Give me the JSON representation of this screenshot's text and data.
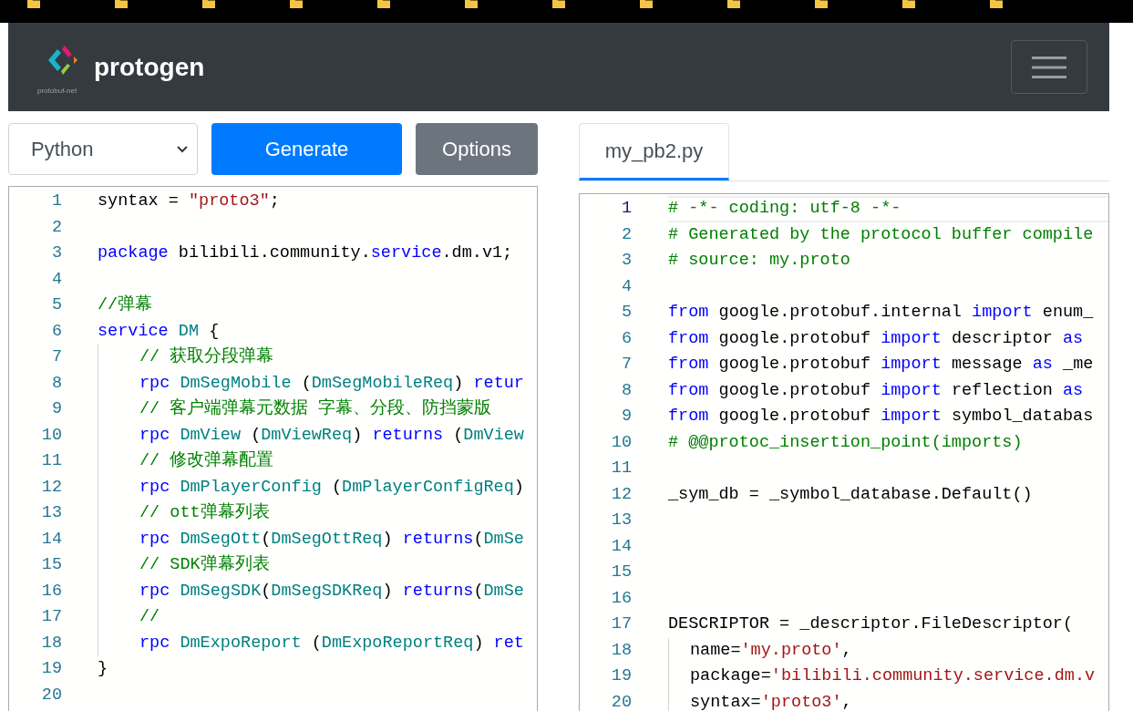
{
  "navbar": {
    "brand": "protogen",
    "logo_subtitle": "protobuf-net"
  },
  "toolbar": {
    "language": "Python",
    "generate": "Generate",
    "options": "Options"
  },
  "input_editor": {
    "lines": [
      {
        "number": "1",
        "indent": false,
        "tokens": [
          {
            "kind": "plain",
            "text": "syntax = "
          },
          {
            "kind": "str",
            "text": "\"proto3\""
          },
          {
            "kind": "plain",
            "text": ";"
          }
        ]
      },
      {
        "number": "2",
        "indent": false
      },
      {
        "number": "3",
        "indent": false,
        "tokens": [
          {
            "kind": "kw",
            "text": "package"
          },
          {
            "kind": "plain",
            "text": " bilibili.community."
          },
          {
            "kind": "kw",
            "text": "service"
          },
          {
            "kind": "plain",
            "text": ".dm.v1;"
          }
        ]
      },
      {
        "number": "4",
        "indent": false
      },
      {
        "number": "5",
        "indent": false,
        "tokens": [
          {
            "kind": "cm",
            "text": "//弹幕"
          }
        ]
      },
      {
        "number": "6",
        "indent": false,
        "tokens": [
          {
            "kind": "kw",
            "text": "service"
          },
          {
            "kind": "type",
            "text": " DM"
          },
          {
            "kind": "plain",
            "text": " {"
          }
        ]
      },
      {
        "number": "7",
        "indent": true,
        "tokens": [
          {
            "kind": "cm",
            "text": "// 获取分段弹幕"
          }
        ]
      },
      {
        "number": "8",
        "indent": true,
        "tokens": [
          {
            "kind": "kw",
            "text": "rpc"
          },
          {
            "kind": "type",
            "text": " DmSegMobile"
          },
          {
            "kind": "plain",
            "text": " ("
          },
          {
            "kind": "type",
            "text": "DmSegMobileReq"
          },
          {
            "kind": "plain",
            "text": ") "
          },
          {
            "kind": "kw",
            "text": "retur"
          }
        ]
      },
      {
        "number": "9",
        "indent": true,
        "tokens": [
          {
            "kind": "cm",
            "text": "// 客户端弹幕元数据 字幕、分段、防挡蒙版"
          }
        ]
      },
      {
        "number": "10",
        "indent": true,
        "tokens": [
          {
            "kind": "kw",
            "text": "rpc"
          },
          {
            "kind": "type",
            "text": " DmView"
          },
          {
            "kind": "plain",
            "text": " ("
          },
          {
            "kind": "type",
            "text": "DmViewReq"
          },
          {
            "kind": "plain",
            "text": ") "
          },
          {
            "kind": "kw",
            "text": "returns"
          },
          {
            "kind": "plain",
            "text": " ("
          },
          {
            "kind": "type",
            "text": "DmView"
          }
        ]
      },
      {
        "number": "11",
        "indent": true,
        "tokens": [
          {
            "kind": "cm",
            "text": "// 修改弹幕配置"
          }
        ]
      },
      {
        "number": "12",
        "indent": true,
        "tokens": [
          {
            "kind": "kw",
            "text": "rpc"
          },
          {
            "kind": "type",
            "text": " DmPlayerConfig"
          },
          {
            "kind": "plain",
            "text": " ("
          },
          {
            "kind": "type",
            "text": "DmPlayerConfigReq"
          },
          {
            "kind": "plain",
            "text": ")"
          }
        ]
      },
      {
        "number": "13",
        "indent": true,
        "tokens": [
          {
            "kind": "cm",
            "text": "// ott弹幕列表"
          }
        ]
      },
      {
        "number": "14",
        "indent": true,
        "tokens": [
          {
            "kind": "kw",
            "text": "rpc"
          },
          {
            "kind": "type",
            "text": " DmSegOtt"
          },
          {
            "kind": "plain",
            "text": "("
          },
          {
            "kind": "type",
            "text": "DmSegOttReq"
          },
          {
            "kind": "plain",
            "text": ") "
          },
          {
            "kind": "kw",
            "text": "returns"
          },
          {
            "kind": "plain",
            "text": "("
          },
          {
            "kind": "type",
            "text": "DmSe"
          }
        ]
      },
      {
        "number": "15",
        "indent": true,
        "tokens": [
          {
            "kind": "cm",
            "text": "// SDK弹幕列表"
          }
        ]
      },
      {
        "number": "16",
        "indent": true,
        "tokens": [
          {
            "kind": "kw",
            "text": "rpc"
          },
          {
            "kind": "type",
            "text": " DmSegSDK"
          },
          {
            "kind": "plain",
            "text": "("
          },
          {
            "kind": "type",
            "text": "DmSegSDKReq"
          },
          {
            "kind": "plain",
            "text": ") "
          },
          {
            "kind": "kw",
            "text": "returns"
          },
          {
            "kind": "plain",
            "text": "("
          },
          {
            "kind": "type",
            "text": "DmSe"
          }
        ]
      },
      {
        "number": "17",
        "indent": true,
        "tokens": [
          {
            "kind": "cm",
            "text": "//"
          }
        ]
      },
      {
        "number": "18",
        "indent": true,
        "tokens": [
          {
            "kind": "kw",
            "text": "rpc"
          },
          {
            "kind": "type",
            "text": " DmExpoReport"
          },
          {
            "kind": "plain",
            "text": " ("
          },
          {
            "kind": "type",
            "text": "DmExpoReportReq"
          },
          {
            "kind": "plain",
            "text": ") "
          },
          {
            "kind": "kw",
            "text": "ret"
          }
        ]
      },
      {
        "number": "19",
        "indent": false,
        "tokens": [
          {
            "kind": "plain",
            "text": "}"
          }
        ]
      },
      {
        "number": "20",
        "indent": false
      }
    ]
  },
  "output_tabs": [
    {
      "label": "my_pb2.py",
      "selected": true
    }
  ],
  "output_editor": {
    "lines": [
      {
        "number": "1",
        "indent": false,
        "active": true,
        "tokens": [
          {
            "kind": "cm",
            "text": "# -*- coding: utf-8 -*-"
          }
        ]
      },
      {
        "number": "2",
        "indent": false,
        "active": false,
        "tokens": [
          {
            "kind": "cm",
            "text": "# Generated by the protocol buffer compile"
          }
        ]
      },
      {
        "number": "3",
        "indent": false,
        "active": false,
        "tokens": [
          {
            "kind": "cm",
            "text": "# source: my.proto"
          }
        ]
      },
      {
        "number": "4",
        "indent": false,
        "active": false
      },
      {
        "number": "5",
        "indent": false,
        "active": false,
        "tokens": [
          {
            "kind": "kw",
            "text": "from"
          },
          {
            "kind": "plain",
            "text": " google.protobuf.internal "
          },
          {
            "kind": "kw",
            "text": "import"
          },
          {
            "kind": "plain",
            "text": " enum_"
          }
        ]
      },
      {
        "number": "6",
        "indent": false,
        "active": false,
        "tokens": [
          {
            "kind": "kw",
            "text": "from"
          },
          {
            "kind": "plain",
            "text": " google.protobuf "
          },
          {
            "kind": "kw",
            "text": "import"
          },
          {
            "kind": "plain",
            "text": " descriptor "
          },
          {
            "kind": "kw",
            "text": "as"
          }
        ]
      },
      {
        "number": "7",
        "indent": false,
        "active": false,
        "tokens": [
          {
            "kind": "kw",
            "text": "from"
          },
          {
            "kind": "plain",
            "text": " google.protobuf "
          },
          {
            "kind": "kw",
            "text": "import"
          },
          {
            "kind": "plain",
            "text": " message "
          },
          {
            "kind": "kw",
            "text": "as"
          },
          {
            "kind": "plain",
            "text": " _me"
          }
        ]
      },
      {
        "number": "8",
        "indent": false,
        "active": false,
        "tokens": [
          {
            "kind": "kw",
            "text": "from"
          },
          {
            "kind": "plain",
            "text": " google.protobuf "
          },
          {
            "kind": "kw",
            "text": "import"
          },
          {
            "kind": "plain",
            "text": " reflection "
          },
          {
            "kind": "kw",
            "text": "as"
          }
        ]
      },
      {
        "number": "9",
        "indent": false,
        "active": false,
        "tokens": [
          {
            "kind": "kw",
            "text": "from"
          },
          {
            "kind": "plain",
            "text": " google.protobuf "
          },
          {
            "kind": "kw",
            "text": "import"
          },
          {
            "kind": "plain",
            "text": " symbol_databas"
          }
        ]
      },
      {
        "number": "10",
        "indent": false,
        "active": false,
        "tokens": [
          {
            "kind": "cm",
            "text": "# @@protoc_insertion_point(imports)"
          }
        ]
      },
      {
        "number": "11",
        "indent": false,
        "active": false
      },
      {
        "number": "12",
        "indent": false,
        "active": false,
        "tokens": [
          {
            "kind": "plain",
            "text": "_sym_db = _symbol_database.Default()"
          }
        ]
      },
      {
        "number": "13",
        "indent": false,
        "active": false
      },
      {
        "number": "14",
        "indent": false,
        "active": false
      },
      {
        "number": "15",
        "indent": false,
        "active": false
      },
      {
        "number": "16",
        "indent": false,
        "active": false
      },
      {
        "number": "17",
        "indent": false,
        "active": false,
        "tokens": [
          {
            "kind": "plain",
            "text": "DESCRIPTOR = _descriptor.FileDescriptor("
          }
        ]
      },
      {
        "number": "18",
        "indent": true,
        "active": false,
        "tokens": [
          {
            "kind": "plain",
            "text": "name="
          },
          {
            "kind": "str",
            "text": "'my.proto'"
          },
          {
            "kind": "plain",
            "text": ","
          }
        ]
      },
      {
        "number": "19",
        "indent": true,
        "active": false,
        "tokens": [
          {
            "kind": "plain",
            "text": "package="
          },
          {
            "kind": "str",
            "text": "'bilibili.community.service.dm.v"
          }
        ]
      },
      {
        "number": "20",
        "indent": true,
        "active": false,
        "tokens": [
          {
            "kind": "plain",
            "text": "syntax="
          },
          {
            "kind": "str",
            "text": "'proto3'"
          },
          {
            "kind": "plain",
            "text": ","
          }
        ]
      }
    ]
  }
}
